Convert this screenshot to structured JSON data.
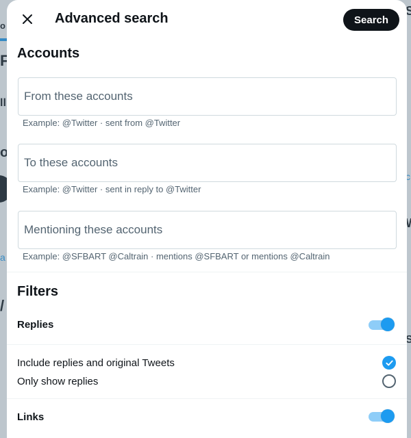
{
  "modal": {
    "title": "Advanced search",
    "search_button": "Search",
    "close_icon": "close-icon"
  },
  "accounts": {
    "heading": "Accounts",
    "fields": [
      {
        "placeholder": "From these accounts",
        "value": "",
        "hint": "Example: @Twitter · sent from @Twitter"
      },
      {
        "placeholder": "To these accounts",
        "value": "",
        "hint": "Example: @Twitter · sent in reply to @Twitter"
      },
      {
        "placeholder": "Mentioning these accounts",
        "value": "",
        "hint": "Example: @SFBART @Caltrain · mentions @SFBART or mentions @Caltrain"
      }
    ]
  },
  "filters": {
    "heading": "Filters",
    "replies": {
      "label": "Replies",
      "enabled": true,
      "options": [
        {
          "label": "Include replies and original Tweets",
          "selected": true
        },
        {
          "label": "Only show replies",
          "selected": false
        }
      ]
    },
    "links": {
      "label": "Links",
      "enabled": true
    }
  },
  "colors": {
    "accent": "#1d9bf0",
    "toggle_track": "#8ecdf8",
    "text_primary": "#0f1419",
    "text_secondary": "#536471",
    "border": "#cfd9de",
    "search_button_bg": "#0f1419"
  }
}
